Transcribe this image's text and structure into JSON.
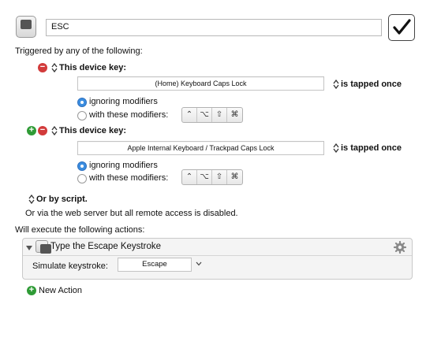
{
  "macro": {
    "name_value": "ESC",
    "enabled": true
  },
  "triggers": {
    "header": "Triggered by any of the following:",
    "items": [
      {
        "label": "This device key:",
        "device": "(Home) Keyboard Caps Lock",
        "condition": "is tapped once",
        "ignoring_label": "ignoring modifiers",
        "with_label": "with these modifiers:",
        "ignoring_selected": true
      },
      {
        "label": "This device key:",
        "device": "Apple Internal Keyboard / Trackpad Caps Lock",
        "condition": "is tapped once",
        "ignoring_label": "ignoring modifiers",
        "with_label": "with these modifiers:",
        "ignoring_selected": true
      }
    ],
    "modifier_glyphs": [
      "⌃",
      "⌥",
      "⇧",
      "⌘"
    ],
    "or_by_script": "Or by script.",
    "web_server_note": "Or via the web server but all remote access is disabled."
  },
  "actions": {
    "header": "Will execute the following actions:",
    "items": [
      {
        "title": "Type the Escape Keystroke",
        "simulate_label": "Simulate keystroke:",
        "keystroke_value": "Escape"
      }
    ],
    "new_action_label": "New Action"
  },
  "icons": {
    "keyboard": "keyboard-icon",
    "gear": "gear-icon",
    "disclosure": "disclosure-triangle-icon",
    "add": "add-icon",
    "remove": "remove-icon",
    "popup_arrows": "updown-arrows-icon"
  },
  "colors": {
    "remove_red": "#d23b3b",
    "add_green": "#2f9b36",
    "radio_selected_blue": "#3b8de0"
  }
}
